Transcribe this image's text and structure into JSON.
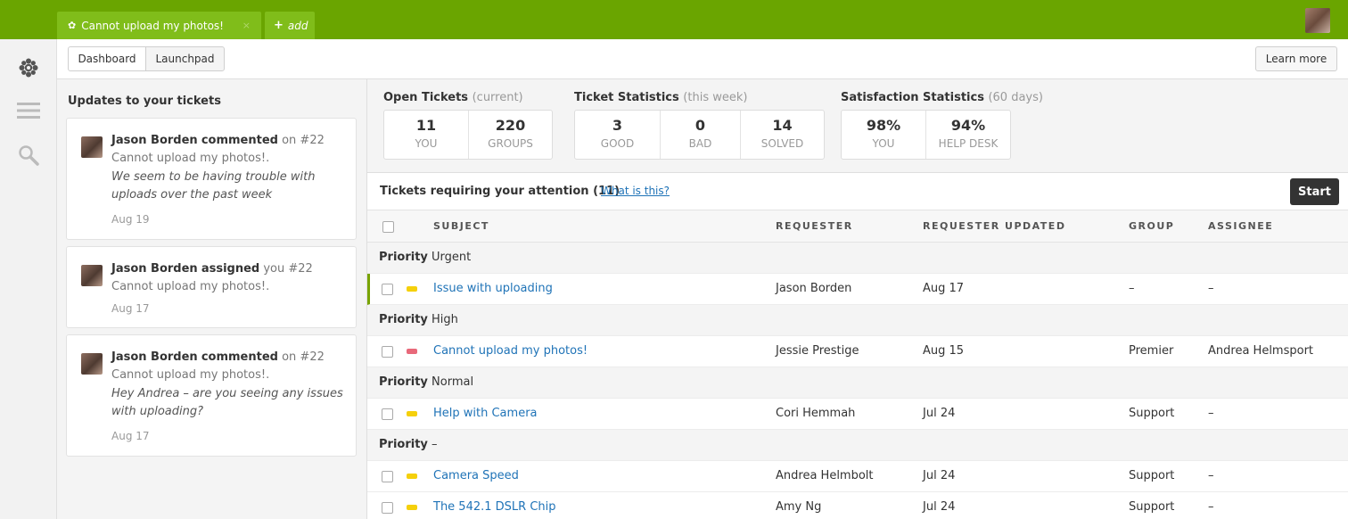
{
  "tabs": {
    "ticket_label": "Cannot upload my photos!",
    "close_glyph": "×",
    "add_label": "add"
  },
  "subnav": {
    "dashboard": "Dashboard",
    "launchpad": "Launchpad"
  },
  "learn_more": "Learn more",
  "updates": {
    "title": "Updates to your tickets",
    "items": [
      {
        "name": "Jason Borden",
        "verb": "commented",
        "rest": " on #22 Cannot upload my photos!.",
        "quote": "We seem to be having trouble with uploads over the past week",
        "date": "Aug 19"
      },
      {
        "name": "Jason Borden",
        "verb": "assigned",
        "rest": " you #22 Cannot upload my photos!.",
        "quote": "",
        "date": "Aug 17"
      },
      {
        "name": "Jason Borden",
        "verb": "commented",
        "rest": " on #22 Cannot upload my photos!.",
        "quote": "Hey Andrea – are you seeing any issues with uploading?",
        "date": "Aug 17"
      }
    ]
  },
  "stats": {
    "open": {
      "title": "Open Tickets",
      "note": "(current)",
      "cells": [
        {
          "num": "11",
          "label": "YOU"
        },
        {
          "num": "220",
          "label": "GROUPS"
        }
      ]
    },
    "ticket": {
      "title": "Ticket Statistics",
      "note": "(this week)",
      "cells": [
        {
          "num": "3",
          "label": "GOOD"
        },
        {
          "num": "0",
          "label": "BAD"
        },
        {
          "num": "14",
          "label": "SOLVED"
        }
      ]
    },
    "satisfaction": {
      "title": "Satisfaction Statistics",
      "note": "(60 days)",
      "cells": [
        {
          "num": "98%",
          "label": "YOU"
        },
        {
          "num": "94%",
          "label": "HELP DESK"
        }
      ]
    }
  },
  "attention": {
    "text": "Tickets requiring your attention (11)",
    "link": "What is this?",
    "start": "Start"
  },
  "table": {
    "headers": {
      "subject": "SUBJECT",
      "requester": "REQUESTER",
      "updated": "REQUESTER UPDATED",
      "group": "GROUP",
      "assignee": "ASSIGNEE"
    },
    "priority_word": "Priority",
    "groups": [
      {
        "priority": "Urgent",
        "rows": [
          {
            "subject": "Issue with uploading",
            "requester": "Jason Borden",
            "updated": "Aug 17",
            "group": "–",
            "assignee": "–",
            "color": "#f5d00b"
          }
        ]
      },
      {
        "priority": "High",
        "rows": [
          {
            "subject": "Cannot upload my photos!",
            "requester": "Jessie Prestige",
            "updated": "Aug 15",
            "group": "Premier",
            "assignee": "Andrea Helmsport",
            "color": "#e8697a"
          }
        ]
      },
      {
        "priority": "Normal",
        "rows": [
          {
            "subject": "Help with Camera",
            "requester": "Cori Hemmah",
            "updated": "Jul 24",
            "group": "Support",
            "assignee": "–",
            "color": "#f5d00b"
          }
        ]
      },
      {
        "priority": "–",
        "rows": [
          {
            "subject": "Camera Speed",
            "requester": "Andrea Helmbolt",
            "updated": "Jul 24",
            "group": "Support",
            "assignee": "–",
            "color": "#f5d00b"
          },
          {
            "subject": "The 542.1 DSLR Chip",
            "requester": "Amy Ng",
            "updated": "Jul 24",
            "group": "Support",
            "assignee": "–",
            "color": "#f5d00b"
          }
        ]
      }
    ]
  },
  "colors": {
    "brand": "#6aa500",
    "link": "#1f73b7"
  }
}
